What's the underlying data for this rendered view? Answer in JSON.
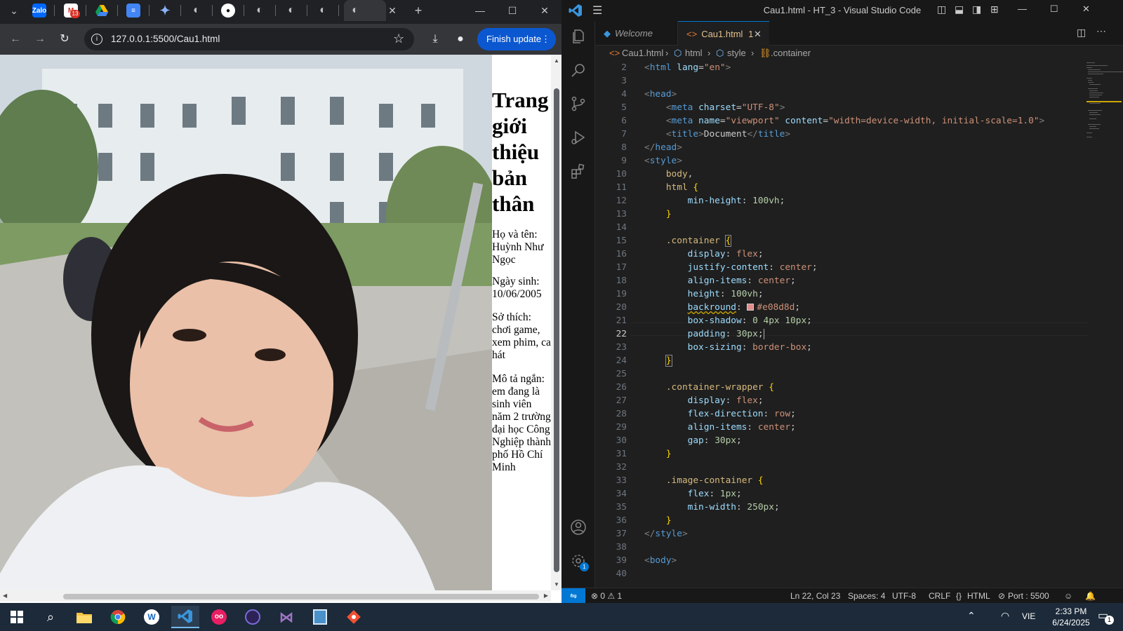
{
  "browser": {
    "tabs": [
      {
        "name": "zalo",
        "icon": "zalo-icon"
      },
      {
        "name": "gmail",
        "icon": "gmail-icon",
        "badge": "13"
      },
      {
        "name": "google-drive",
        "icon": "google-drive-icon"
      },
      {
        "name": "google-docs",
        "icon": "google-docs-icon"
      },
      {
        "name": "gemini",
        "icon": "gemini-icon"
      },
      {
        "name": "tab-6",
        "icon": "globe-icon"
      },
      {
        "name": "github",
        "icon": "github-icon"
      },
      {
        "name": "tab-8",
        "icon": "globe-icon"
      },
      {
        "name": "tab-9",
        "icon": "globe-icon"
      },
      {
        "name": "tab-10",
        "icon": "globe-icon"
      },
      {
        "name": "tab-11",
        "icon": "globe-icon"
      }
    ],
    "url": "127.0.0.1:5500/Cau1.html",
    "finish_update_label": "Finish update",
    "page": {
      "title": "Trang giới thiệu bản thân",
      "name": "Họ và tên: Huỳnh Như Ngọc",
      "birthday": "Ngày sinh: 10/06/2005",
      "hobbies": "Sở thích: chơi game, xem phim, ca hát",
      "description": "Mô tả ngắn: em đang là sinh viên năm 2 trường đại học Công Nghiệp thành phố Hồ Chí Minh"
    }
  },
  "vscode": {
    "window_title": "Cau1.html - HT_3 - Visual Studio Code",
    "tabs": [
      {
        "label": "Welcome",
        "active": false
      },
      {
        "label": "Cau1.html",
        "problems": "1",
        "active": true
      }
    ],
    "breadcrumb": [
      "Cau1.html",
      "html",
      "style",
      ".container"
    ],
    "code_lines": [
      {
        "n": "2"
      },
      {
        "n": "3"
      },
      {
        "n": "4"
      },
      {
        "n": "5"
      },
      {
        "n": "6"
      },
      {
        "n": "7"
      },
      {
        "n": "8"
      },
      {
        "n": "9"
      },
      {
        "n": "10"
      },
      {
        "n": "11"
      },
      {
        "n": "12"
      },
      {
        "n": "13"
      },
      {
        "n": "14"
      },
      {
        "n": "15"
      },
      {
        "n": "16"
      },
      {
        "n": "17"
      },
      {
        "n": "18"
      },
      {
        "n": "19"
      },
      {
        "n": "20"
      },
      {
        "n": "21"
      },
      {
        "n": "22"
      },
      {
        "n": "23"
      },
      {
        "n": "24"
      },
      {
        "n": "25"
      },
      {
        "n": "26"
      },
      {
        "n": "27"
      },
      {
        "n": "28"
      },
      {
        "n": "29"
      },
      {
        "n": "30"
      },
      {
        "n": "31"
      },
      {
        "n": "32"
      },
      {
        "n": "33"
      },
      {
        "n": "34"
      },
      {
        "n": "35"
      },
      {
        "n": "36"
      },
      {
        "n": "37"
      },
      {
        "n": "38"
      },
      {
        "n": "39"
      },
      {
        "n": "40"
      }
    ],
    "current_line": "22",
    "swatch_color": "#e08d8d",
    "status": {
      "errors": "0",
      "warnings": "1",
      "position": "Ln 22, Col 23",
      "spaces": "Spaces: 4",
      "encoding": "UTF-8",
      "eol": "CRLF",
      "language": "HTML",
      "port": "Port : 5500",
      "notifications": "1"
    }
  },
  "taskbar": {
    "apps": [
      "windows-start",
      "search",
      "file-explorer",
      "chrome",
      "app-4",
      "vscode",
      "app-6",
      "app-7",
      "visual-studio",
      "app-9",
      "git-app"
    ],
    "language": "VIE",
    "time": "2:33 PM",
    "date": "6/24/2025",
    "notification_count": "1"
  },
  "colors": {
    "accent_blue": "#0078d4",
    "finish_update_bg": "#0b57d0"
  }
}
